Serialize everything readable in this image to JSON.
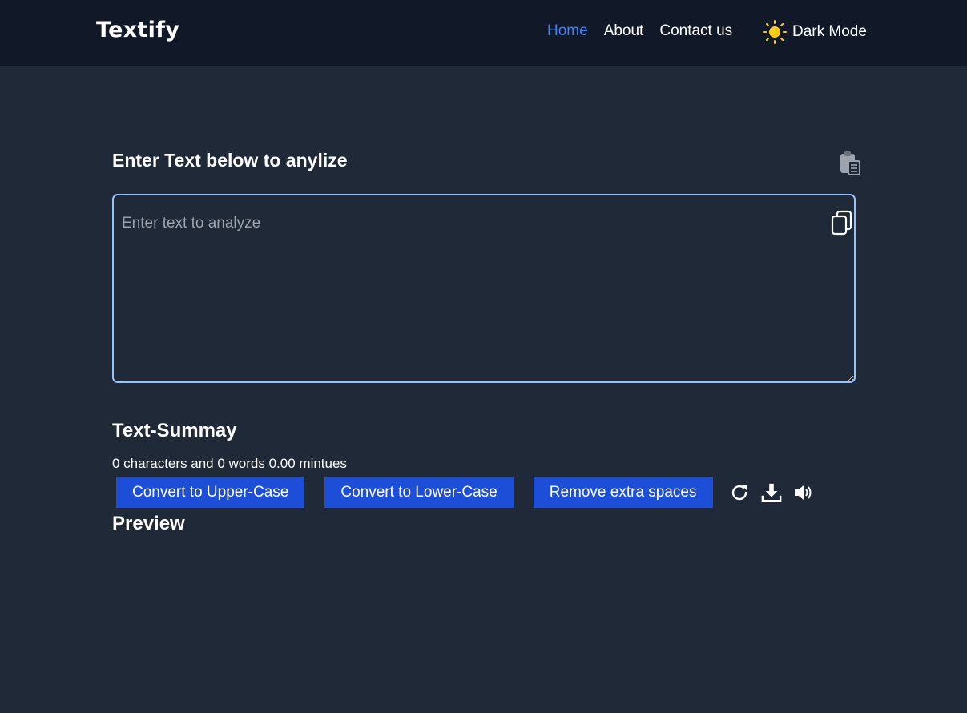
{
  "app": {
    "brand": "Textify"
  },
  "nav": {
    "links": [
      {
        "label": "Home",
        "active": true
      },
      {
        "label": "About",
        "active": false
      },
      {
        "label": "Contact us",
        "active": false
      }
    ],
    "dark_mode_label": "Dark Mode",
    "dark_mode_icon": "sun-icon"
  },
  "editor": {
    "heading": "Enter Text below to anylize",
    "placeholder": "Enter text to analyze",
    "value": "",
    "clipboard_icon": "clipboard-icon",
    "copy_icon": "copy-icon"
  },
  "summary": {
    "heading": "Text-Summay",
    "stats": "0 characters and 0 words 0.00 mintues"
  },
  "actions": {
    "upper_label": "Convert to Upper-Case",
    "lower_label": "Convert to Lower-Case",
    "spaces_label": "Remove extra spaces",
    "icons": [
      "refresh-icon",
      "download-icon",
      "speaker-icon"
    ]
  },
  "preview": {
    "heading": "Preview"
  },
  "colors": {
    "background": "#1f2937",
    "navbar": "#111827",
    "accent": "#3b82f6",
    "button": "#1d4ed8",
    "textarea_border": "#93c5fd",
    "sun": "#facc15"
  }
}
